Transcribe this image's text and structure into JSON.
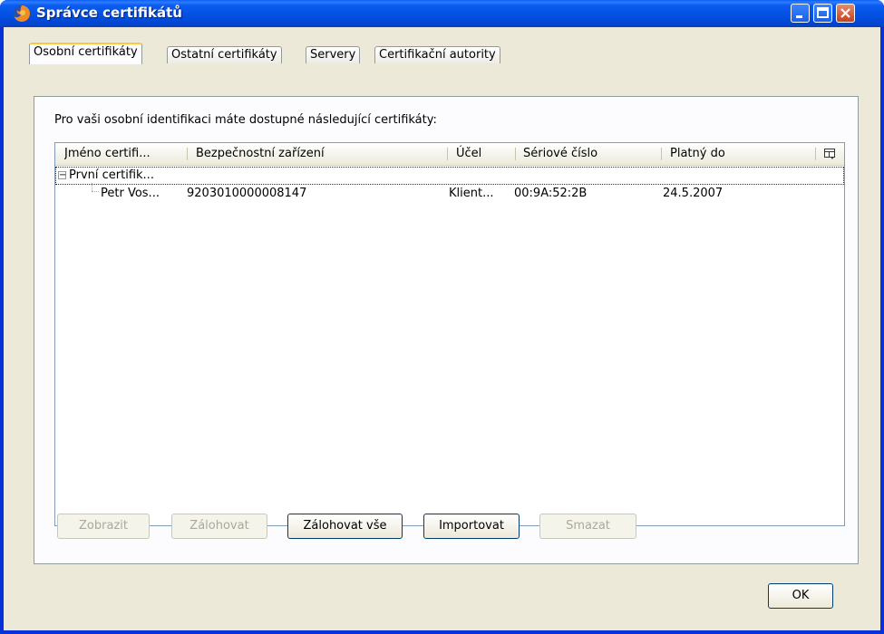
{
  "window": {
    "title": "Správce certifikátů"
  },
  "tabs": [
    {
      "label": "Osobní certifikáty",
      "active": true
    },
    {
      "label": "Ostatní certifikáty",
      "active": false
    },
    {
      "label": "Servery",
      "active": false
    },
    {
      "label": "Certifikační autority",
      "active": false
    }
  ],
  "panel": {
    "intro": "Pro vaši osobní identifikaci máte dostupné následující certifikáty:"
  },
  "tree": {
    "columns": [
      "Jméno certifi...",
      "Bezpečnostní zařízení",
      "Účel",
      "Sériové číslo",
      "Platný do"
    ],
    "group_label": "První certifik...",
    "group_expander": "−",
    "rows": [
      {
        "name": "Petr Vos...",
        "device": "9203010000008147",
        "purpose": "Klient...",
        "serial": "00:9A:52:2B",
        "valid_to": "24.5.2007"
      }
    ]
  },
  "buttons": {
    "view": {
      "label": "Zobrazit",
      "enabled": false
    },
    "backup": {
      "label": "Zálohovat",
      "enabled": false
    },
    "backup_all": {
      "label": "Zálohovat vše",
      "enabled": true
    },
    "import": {
      "label": "Importovat",
      "enabled": true
    },
    "delete": {
      "label": "Smazat",
      "enabled": false
    },
    "ok": {
      "label": "OK",
      "enabled": true
    }
  },
  "icons": {
    "app": "firefox-icon",
    "column_picker": "column-picker-icon"
  },
  "colors": {
    "titlebar": "#0350e0",
    "dialog_bg": "#ece9d8",
    "active_tab_accent": "#ffc83c",
    "close_button": "#c5401f"
  }
}
